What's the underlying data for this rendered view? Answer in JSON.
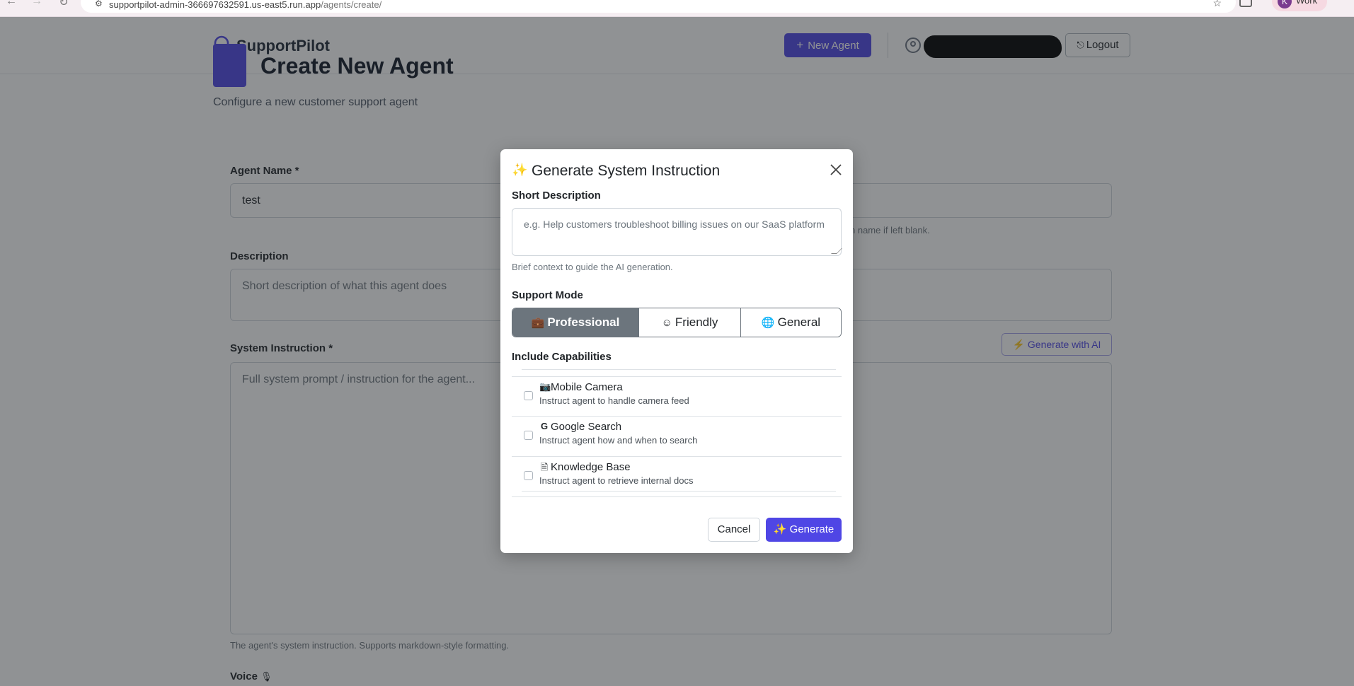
{
  "browser": {
    "back_icon": "←",
    "forward_icon": "→",
    "reload_icon": "↻",
    "url_host": "supportpilot-admin-366697632591.us-east5.run.app",
    "url_path": "/agents/create/",
    "profile_initial": "K",
    "profile_label": "Work"
  },
  "header": {
    "brand": "SupportPilot",
    "new_agent_label": "New Agent",
    "logout_label": "Logout"
  },
  "page": {
    "title": "Create New Agent",
    "subtitle": "Configure a new customer support agent"
  },
  "form": {
    "agent_name_label": "Agent Name *",
    "agent_name_value": "test",
    "name_help_tail": "n name if left blank.",
    "description_label": "Description",
    "description_placeholder": "Short description of what this agent does",
    "system_instruction_label": "System Instruction *",
    "system_instruction_placeholder": "Full system prompt / instruction for the agent...",
    "generate_ai_label": "Generate with AI",
    "system_instruction_help": "The agent's system instruction. Supports markdown-style formatting.",
    "voice_label": "Voice"
  },
  "modal": {
    "title": "Generate System Instruction",
    "short_description_label": "Short Description",
    "short_description_placeholder": "e.g. Help customers troubleshoot billing issues on our SaaS platform",
    "short_description_help": "Brief context to guide the AI generation.",
    "support_mode_label": "Support Mode",
    "modes": [
      {
        "label": "Professional",
        "icon": "briefcase-icon",
        "active": true
      },
      {
        "label": "Friendly",
        "icon": "smile-icon",
        "active": false
      },
      {
        "label": "General",
        "icon": "globe-icon",
        "active": false
      }
    ],
    "capabilities_label": "Include Capabilities",
    "capabilities": [
      {
        "title": "Mobile Camera",
        "desc": "Instruct agent to handle camera feed",
        "icon": "camera-icon",
        "checked": false
      },
      {
        "title": "Google Search",
        "desc": "Instruct agent how and when to search",
        "icon": "google-icon",
        "checked": false
      },
      {
        "title": "Knowledge Base",
        "desc": "Instruct agent to retrieve internal docs",
        "icon": "document-icon",
        "checked": false
      }
    ],
    "cancel_label": "Cancel",
    "generate_label": "Generate"
  },
  "colors": {
    "primary": "#4f46e5",
    "active_mode": "#6c757d",
    "overlay": "rgba(33,37,41,0.5)"
  }
}
